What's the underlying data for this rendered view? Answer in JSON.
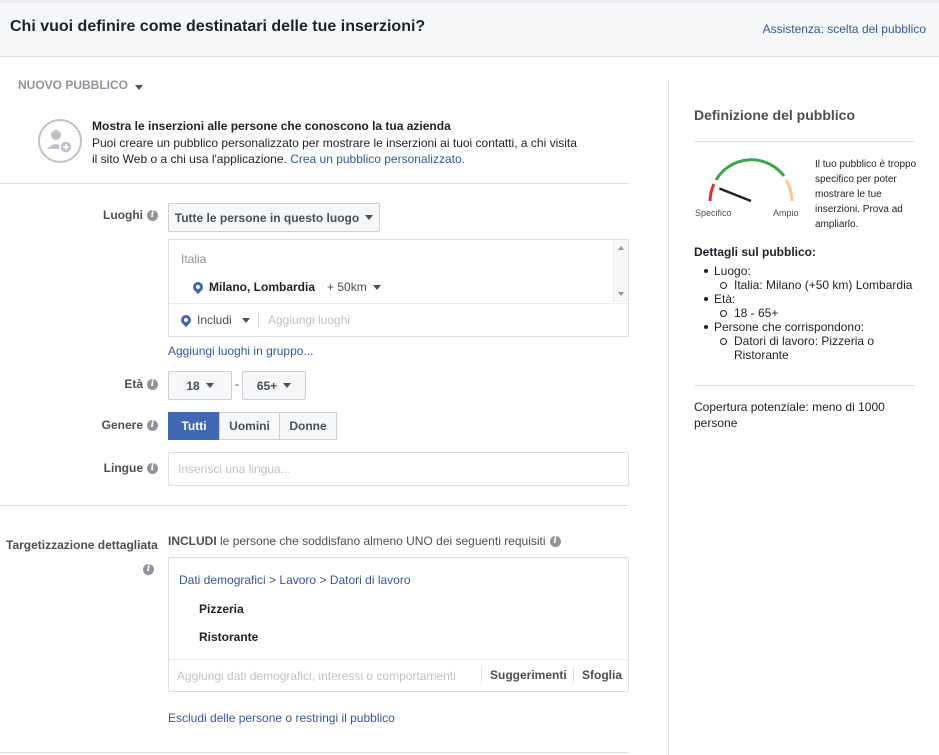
{
  "header": {
    "title": "Chi vuoi definire come destinatari delle tue inserzioni?",
    "help_link": "Assistenza: scelta del pubblico"
  },
  "audience_selector": {
    "label": "NUOVO PUBBLICO"
  },
  "custom_audience": {
    "heading": "Mostra le inserzioni alle persone che conoscono la tua azienda",
    "body_1": "Puoi creare un pubblico personalizzato per mostrare le inserzioni ai tuoi contatti, a chi visita",
    "body_2": "il sito Web o a chi usa l'applicazione.",
    "link": "Crea un pubblico personalizzato."
  },
  "locations": {
    "label": "Luoghi",
    "dropdown_value": "Tutte le persone in questo luogo",
    "country": "Italia",
    "city": "Milano, Lombardia",
    "radius": "+ 50km",
    "include_label": "Includi",
    "add_placeholder": "Aggiungi luoghi",
    "bulk_link": "Aggiungi luoghi in gruppo..."
  },
  "age": {
    "label": "Età",
    "min": "18",
    "max": "65+",
    "separator": "-"
  },
  "gender": {
    "label": "Genere",
    "options": [
      "Tutti",
      "Uomini",
      "Donne"
    ],
    "selected": "Tutti"
  },
  "languages": {
    "label": "Lingue",
    "placeholder": "Inserisci una lingua..."
  },
  "detailed_targeting": {
    "label": "Targetizzazione dettagliata",
    "include_prefix": "INCLUDI",
    "include_text": "le persone che soddisfano almeno UNO dei seguenti requisiti",
    "breadcrumb_1": "Dati demografici",
    "breadcrumb_2": "Lavoro",
    "breadcrumb_3": "Datori di lavoro",
    "breadcrumb_sep": ">",
    "items": [
      "Pizzeria",
      "Ristorante"
    ],
    "add_placeholder": "Aggiungi dati demografici, interessi o comportamenti",
    "suggestions": "Suggerimenti",
    "browse": "Sfoglia",
    "exclude_link": "Escludi delle persone",
    "or_text": "o",
    "narrow_link": "restringi il pubblico"
  },
  "sidebar": {
    "title": "Definizione del pubblico",
    "gauge_left": "Specifico",
    "gauge_right": "Ampio",
    "gauge_level": 0.12,
    "gauge_text": "Il tuo pubblico è troppo specifico per poter mostrare le tue inserzioni. Prova ad ampliarlo.",
    "details_title": "Dettagli sul pubblico:",
    "details": [
      {
        "label": "Luogo:",
        "sub": "Italia: Milano (+50 km) Lombardia"
      },
      {
        "label": "Età:",
        "sub": "18 - 65+"
      },
      {
        "label": "Persone che corrispondono:",
        "sub": "Datori di lavoro: Pizzeria o Ristorante"
      }
    ],
    "potential_reach": "Copertura potenziale: meno di 1000 persone"
  },
  "colors": {
    "link": "#365899",
    "primary": "#4267b2",
    "gauge_red": "#e02f2f",
    "gauge_green": "#3ea54f",
    "gauge_yellow": "#f7c78d"
  }
}
